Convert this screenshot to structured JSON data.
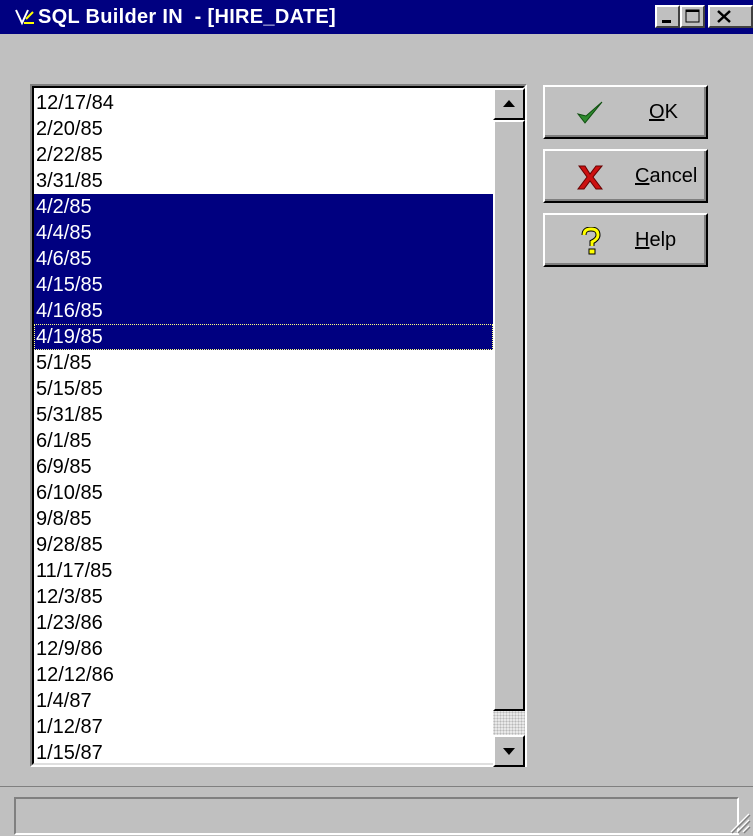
{
  "window": {
    "title": "SQL Builder IN  - [HIRE_DATE]",
    "controls": {
      "minimize": "minimize",
      "maximize": "maximize",
      "close": "close"
    }
  },
  "list": {
    "items": [
      {
        "label": "12/17/84",
        "selected": false
      },
      {
        "label": "2/20/85",
        "selected": false
      },
      {
        "label": "2/22/85",
        "selected": false
      },
      {
        "label": "3/31/85",
        "selected": false
      },
      {
        "label": "4/2/85",
        "selected": true
      },
      {
        "label": "4/4/85",
        "selected": true
      },
      {
        "label": "4/6/85",
        "selected": true
      },
      {
        "label": "4/15/85",
        "selected": true
      },
      {
        "label": "4/16/85",
        "selected": true
      },
      {
        "label": "4/19/85",
        "selected": true,
        "focused": true
      },
      {
        "label": "5/1/85",
        "selected": false
      },
      {
        "label": "5/15/85",
        "selected": false
      },
      {
        "label": "5/31/85",
        "selected": false
      },
      {
        "label": "6/1/85",
        "selected": false
      },
      {
        "label": "6/9/85",
        "selected": false
      },
      {
        "label": "6/10/85",
        "selected": false
      },
      {
        "label": "9/8/85",
        "selected": false
      },
      {
        "label": "9/28/85",
        "selected": false
      },
      {
        "label": "11/17/85",
        "selected": false
      },
      {
        "label": "12/3/85",
        "selected": false
      },
      {
        "label": "1/23/86",
        "selected": false
      },
      {
        "label": "12/9/86",
        "selected": false
      },
      {
        "label": "12/12/86",
        "selected": false
      },
      {
        "label": "1/4/87",
        "selected": false
      },
      {
        "label": "1/12/87",
        "selected": false
      },
      {
        "label": "1/15/87",
        "selected": false
      }
    ]
  },
  "buttons": {
    "ok": {
      "mnemonic": "O",
      "rest": "K",
      "icon": "checkmark-icon"
    },
    "cancel": {
      "mnemonic": "C",
      "rest": "ancel",
      "icon": "red-x-icon"
    },
    "help": {
      "mnemonic": "H",
      "rest": "elp",
      "icon": "question-mark-icon"
    }
  },
  "colors": {
    "titlebar": "#000080",
    "selection": "#000080",
    "face": "#c0c0c0"
  }
}
